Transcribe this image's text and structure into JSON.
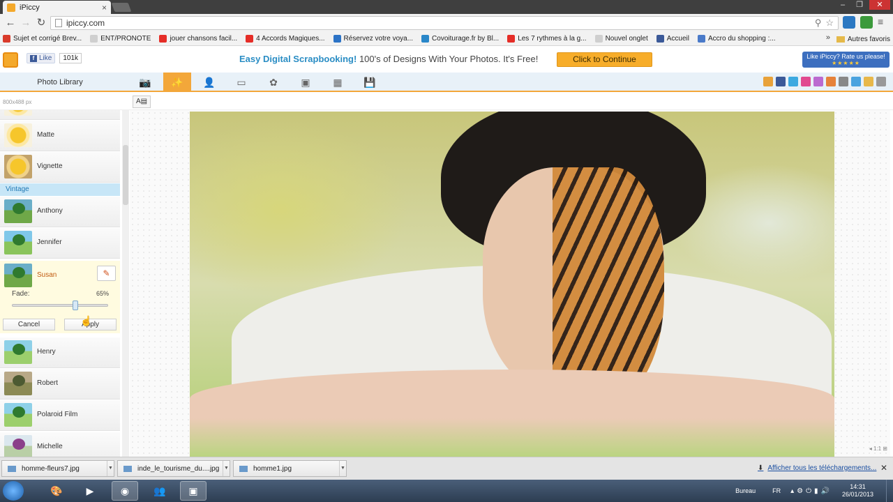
{
  "browser": {
    "tab_title": "iPiccy",
    "url": "ipiccy.com",
    "bookmarks": [
      {
        "label": "Sujet et corrigé Brev...",
        "color": "#d93b2b"
      },
      {
        "label": "ENT/PRONOTE",
        "color": "#cfcfcf"
      },
      {
        "label": "jouer chansons facil...",
        "color": "#e52d27"
      },
      {
        "label": "4 Accords Magiques...",
        "color": "#e52d27"
      },
      {
        "label": "Réservez votre voya...",
        "color": "#2c73c6"
      },
      {
        "label": "Covoiturage.fr by Bl...",
        "color": "#2a87c9"
      },
      {
        "label": "Les 7 rythmes à la g...",
        "color": "#e52d27"
      },
      {
        "label": "Nouvel onglet",
        "color": "#cfcfcf"
      },
      {
        "label": "Accueil",
        "color": "#3b5998"
      },
      {
        "label": "Accro du shopping :...",
        "color": "#4a7ac9"
      }
    ],
    "bookmarks_more": "»",
    "other_bookmarks": "Autres favoris"
  },
  "site": {
    "like_label": "Like",
    "like_count": "101k",
    "promo_strong": "Easy Digital Scrapbooking!",
    "promo_rest": " 100's of Designs With Your Photos. It's Free!",
    "cta_label": "Click to Continue",
    "rate_line": "Like iPiccy? Rate us please!",
    "rate_stars": "★★★★★"
  },
  "app": {
    "photo_library_label": "Photo Library",
    "tools": [
      {
        "name": "camera-icon",
        "glyph": "📷"
      },
      {
        "name": "magic-wand-icon",
        "glyph": "✨"
      },
      {
        "name": "person-icon",
        "glyph": "👤"
      },
      {
        "name": "frame-icon",
        "glyph": "▭"
      },
      {
        "name": "stickers-icon",
        "glyph": "✿"
      },
      {
        "name": "picture-frame-icon",
        "glyph": "▣"
      },
      {
        "name": "texture-icon",
        "glyph": "▦"
      },
      {
        "name": "save-icon",
        "glyph": "💾"
      }
    ],
    "active_tool_index": 1,
    "size_info": "800x488 px",
    "text_tool_label": "A▤",
    "zoom_info": "◂ 1:1 ⊞"
  },
  "sidebar": {
    "effects_top": [
      {
        "label": "Matte"
      },
      {
        "label": "Vignette"
      }
    ],
    "section_title": "Vintage",
    "vintage": [
      {
        "label": "Anthony"
      },
      {
        "label": "Jennifer"
      }
    ],
    "selected": {
      "label": "Susan",
      "fade_label": "Fade:",
      "fade_value": "65%",
      "fade_fraction": 0.65,
      "cancel_label": "Cancel",
      "apply_label": "Apply"
    },
    "more": [
      {
        "label": "Henry"
      },
      {
        "label": "Robert"
      },
      {
        "label": "Polaroid Film"
      },
      {
        "label": "Michelle"
      }
    ]
  },
  "downloads": {
    "items": [
      "homme-fleurs7.jpg",
      "inde_le_tourisme_du....jpg",
      "homme1.jpg"
    ],
    "show_all": "Afficher tous les téléchargements..."
  },
  "taskbar": {
    "bureau": "Bureau",
    "lang": "FR",
    "time": "14:31",
    "date": "26/01/2013"
  }
}
